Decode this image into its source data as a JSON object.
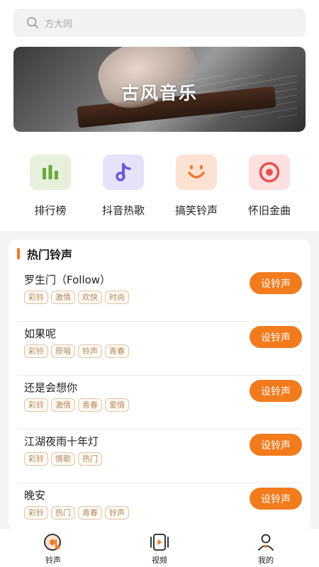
{
  "search": {
    "placeholder": "方大同"
  },
  "banner": {
    "title": "古风音乐"
  },
  "categories": [
    {
      "label": "排行榜",
      "icon": "bar-chart-icon",
      "bg": "#e6f0dc",
      "color": "#6aa83c"
    },
    {
      "label": "抖音热歌",
      "icon": "music-note-icon",
      "bg": "#e5e3f8",
      "color": "#6b5ad6"
    },
    {
      "label": "搞笑铃声",
      "icon": "smile-icon",
      "bg": "#fbe2d3",
      "color": "#f07b2b"
    },
    {
      "label": "怀旧金曲",
      "icon": "record-icon",
      "bg": "#fde0e0",
      "color": "#e85050"
    }
  ],
  "section": {
    "title": "热门铃声"
  },
  "songs": [
    {
      "name": "罗生门（Follow）",
      "tags": [
        "彩铃",
        "激情",
        "欢快",
        "时尚"
      ],
      "button": "设铃声"
    },
    {
      "name": "如果呢",
      "tags": [
        "彩铃",
        "原唱",
        "铃声",
        "青春"
      ],
      "button": "设铃声"
    },
    {
      "name": "还是会想你",
      "tags": [
        "彩铃",
        "激情",
        "青春",
        "爱情"
      ],
      "button": "设铃声"
    },
    {
      "name": "江湖夜雨十年灯",
      "tags": [
        "彩铃",
        "情歌",
        "热门"
      ],
      "button": "设铃声"
    },
    {
      "name": "晚安",
      "tags": [
        "彩铃",
        "热门",
        "青春",
        "铃声"
      ],
      "button": "设铃声"
    }
  ],
  "tabbar": [
    {
      "label": "铃声",
      "icon": "ringtone-icon",
      "active": true
    },
    {
      "label": "视频",
      "icon": "video-icon",
      "active": false
    },
    {
      "label": "我的",
      "icon": "profile-icon",
      "active": false
    }
  ],
  "colors": {
    "accent": "#f27b1d",
    "tag_text": "#b0895d"
  }
}
